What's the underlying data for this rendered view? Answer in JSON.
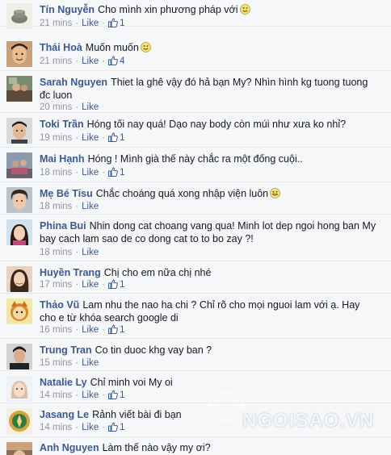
{
  "watermark": "NGOISAO.VN",
  "comments": [
    {
      "author": "Tín Nguyễn",
      "text": "Cho mình xin phương pháp với",
      "emoticon": "smile-emoticon",
      "time": "21 mins",
      "like": "Like",
      "likes": "1"
    },
    {
      "author": "Thái Hoà",
      "text": "Muốn muốn",
      "emoticon": "smile-emoticon",
      "time": "21 mins",
      "like": "Like",
      "likes": "4"
    },
    {
      "author": "Sarah Nguyen",
      "text": "Thiet la ghê vậy đó hả bạn My? Nhìn hình kg tuong tuong đc luon",
      "time": "20 mins",
      "like": "Like"
    },
    {
      "author": "Toki Trần",
      "text": "Hóng tối nay quá! Dạo nay body còn múi như xưa ko nhỉ?",
      "time": "19 mins",
      "like": "Like",
      "likes": "1"
    },
    {
      "author": "Mai Hạnh",
      "text": "Hóng ! Mình già thế này chắc ra một đống cuội..",
      "time": "18 mins",
      "like": "Like",
      "likes": "1"
    },
    {
      "author": "Mẹ Bé Tisu",
      "text": "Chắc choáng quá xong nhập viện luôn",
      "emoticon": "grin-emoticon",
      "time": "18 mins",
      "like": "Like"
    },
    {
      "author": "Phina Bui",
      "text": "Nhin dong cat choang vang qua! Minh lot dep ngoi hong ban My bay cach lam sao de co dong cat to to bo zay ?!",
      "time": "18 mins",
      "like": "Like"
    },
    {
      "author": "Huyền Trang",
      "text": "Chị cho em nữa chị nhé",
      "time": "17 mins",
      "like": "Like",
      "likes": "1"
    },
    {
      "author": "Thảo Vũ",
      "text": "Lam nhu the nao ha chi ? Chỉ rõ cho mọi nguoi lam với ạ. Hay cho e từ khóa search google di",
      "time": "16 mins",
      "like": "Like",
      "likes": "1"
    },
    {
      "author": "Trung Tran",
      "text": "Co tin duoc khg vay ban ?",
      "time": "15 mins",
      "like": "Like"
    },
    {
      "author": "Natalie Ly",
      "text": "Chỉ minh voi My oi",
      "time": "14 mins",
      "like": "Like",
      "likes": "1"
    },
    {
      "author": "Jasang Le",
      "text": "Rảnh viết bài đi bạn",
      "time": "14 mins",
      "like": "Like",
      "likes": "1"
    },
    {
      "author": "Anh Nguyen",
      "text": "Làm thế nào vậy my ơi?"
    }
  ]
}
